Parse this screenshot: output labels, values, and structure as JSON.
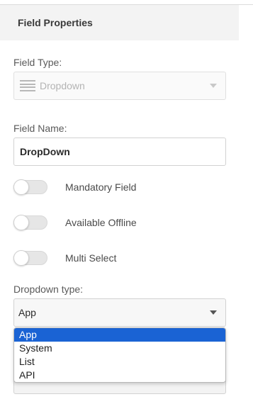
{
  "panel": {
    "title": "Field Properties"
  },
  "field_type": {
    "label": "Field Type:",
    "icon": "list-lines-icon",
    "value": "Dropdown"
  },
  "field_name": {
    "label": "Field Name:",
    "value": "DropDown"
  },
  "toggles": [
    {
      "label": "Mandatory Field",
      "on": false
    },
    {
      "label": "Available Offline",
      "on": false
    },
    {
      "label": "Multi Select",
      "on": false
    }
  ],
  "dropdown_type": {
    "label": "Dropdown type:",
    "value": "App",
    "options": [
      "App",
      "System",
      "List",
      "API"
    ],
    "selected_index": 0
  },
  "colors": {
    "selected_option": "#1a63d4",
    "header_bg": "#f3f3f3"
  }
}
